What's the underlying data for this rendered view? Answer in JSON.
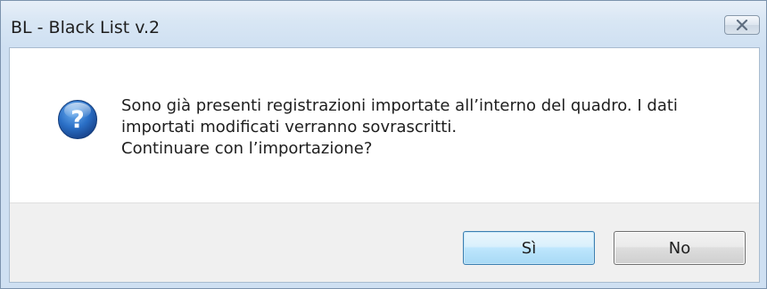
{
  "window": {
    "title": "BL - Black List v.2",
    "close_icon": "close-icon"
  },
  "dialog": {
    "icon": "question-icon",
    "icon_glyph": "?",
    "message_lines": [
      "Sono già presenti registrazioni importate all’interno del quadro. I dati",
      "importati modificati verranno sovrascritti.",
      "Continuare con l’importazione?"
    ]
  },
  "buttons": {
    "yes_label": "Sì",
    "no_label": "No"
  },
  "colors": {
    "frame": "#cfe0f2",
    "icon_blue": "#1f5fb0",
    "default_button_border": "#3c7fb1"
  }
}
